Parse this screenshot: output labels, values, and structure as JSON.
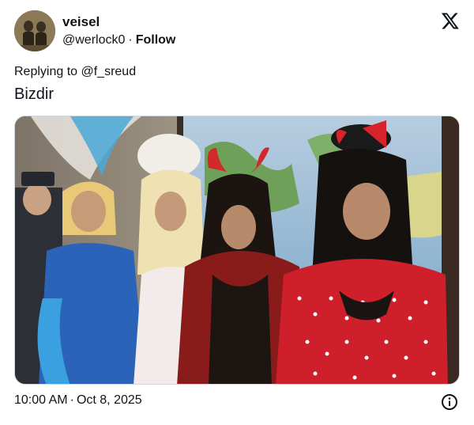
{
  "author": {
    "display_name": "veisel",
    "handle": "@werlock0",
    "separator": "·",
    "follow_label": "Follow",
    "avatar_icon": "avatar-photo-icon"
  },
  "platform": {
    "logo_icon": "x-logo-icon"
  },
  "tweet": {
    "replying_to": "Replying to @f_sreud",
    "text": "Bizdir"
  },
  "media": {
    "kind": "photo",
    "description_icon": "costume-group-photo"
  },
  "footer": {
    "time": "10:00 AM",
    "separator": "·",
    "date": "Oct 8, 2025",
    "info_icon": "info-icon"
  },
  "colors": {
    "text": "#0f1419",
    "border": "#cfd9de",
    "background": "#ffffff"
  }
}
